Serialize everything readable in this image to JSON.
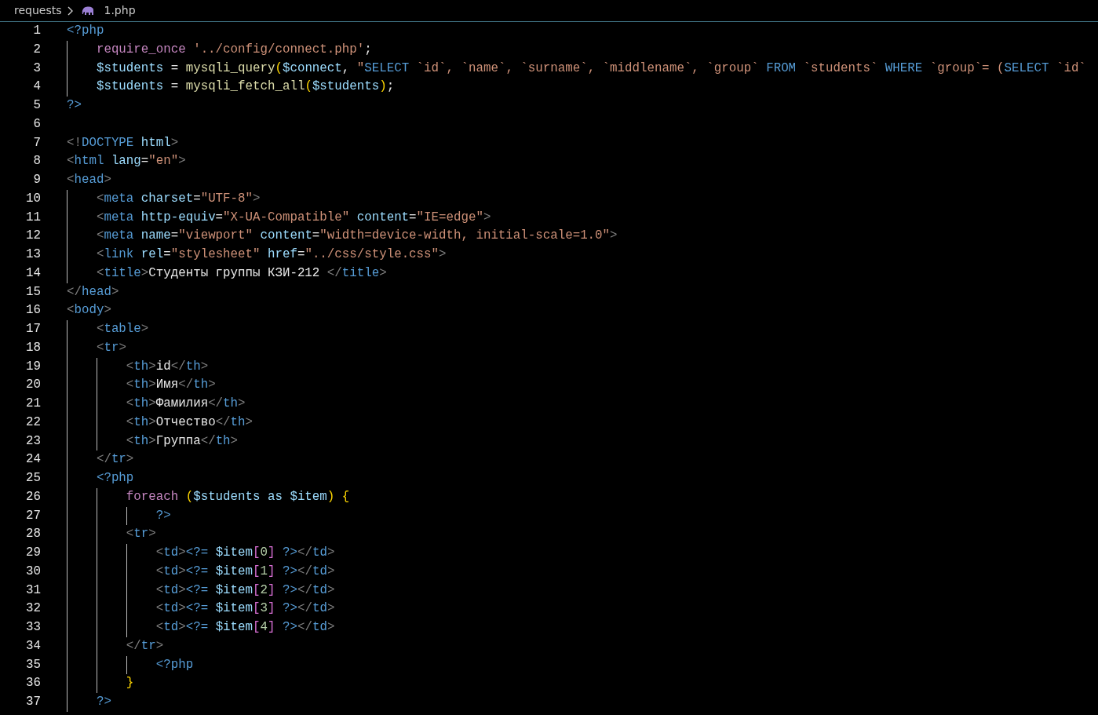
{
  "breadcrumb": {
    "folder": "requests",
    "file": "1.php"
  },
  "lines": [
    {
      "number": "1",
      "tokens": [
        {
          "kind": "php",
          "text": "<?php"
        }
      ]
    },
    {
      "number": "2",
      "tokens": [
        {
          "kind": "kw",
          "text": "    require_once "
        },
        {
          "kind": "str",
          "text": "'../config/connect.php'"
        },
        {
          "kind": "plain",
          "text": ";"
        }
      ]
    },
    {
      "number": "3",
      "tokens": [
        {
          "kind": "var",
          "text": "    $students"
        },
        {
          "kind": "plain",
          "text": " = "
        },
        {
          "kind": "fn",
          "text": "mysqli_query"
        },
        {
          "kind": "br1",
          "text": "("
        },
        {
          "kind": "var",
          "text": "$connect"
        },
        {
          "kind": "plain",
          "text": ", "
        },
        {
          "kind": "str",
          "text": "\""
        },
        {
          "kind": "sql",
          "text": "SELECT"
        },
        {
          "kind": "str",
          "text": " `id`, `name`, `surname`, `middlename`, `group` "
        },
        {
          "kind": "sql",
          "text": "FROM"
        },
        {
          "kind": "str",
          "text": " `students` "
        },
        {
          "kind": "sql",
          "text": "WHERE"
        },
        {
          "kind": "str",
          "text": " `group`= ("
        },
        {
          "kind": "sql",
          "text": "SELECT"
        },
        {
          "kind": "str",
          "text": " `id`"
        }
      ]
    },
    {
      "number": "4",
      "tokens": [
        {
          "kind": "var",
          "text": "    $students"
        },
        {
          "kind": "plain",
          "text": " = "
        },
        {
          "kind": "fn",
          "text": "mysqli_fetch_all"
        },
        {
          "kind": "br1",
          "text": "("
        },
        {
          "kind": "var",
          "text": "$students"
        },
        {
          "kind": "br1",
          "text": ")"
        },
        {
          "kind": "plain",
          "text": ";"
        }
      ]
    },
    {
      "number": "5",
      "tokens": [
        {
          "kind": "php",
          "text": "?>"
        }
      ]
    },
    {
      "number": "6"
    },
    {
      "number": "7",
      "tokens": [
        {
          "kind": "punct",
          "text": "<!"
        },
        {
          "kind": "tag",
          "text": "DOCTYPE "
        },
        {
          "kind": "attr",
          "text": "html"
        },
        {
          "kind": "punct",
          "text": ">"
        }
      ]
    },
    {
      "number": "8",
      "tokens": [
        {
          "kind": "punct",
          "text": "<"
        },
        {
          "kind": "tag",
          "text": "html "
        },
        {
          "kind": "attr",
          "text": "lang"
        },
        {
          "kind": "plain",
          "text": "="
        },
        {
          "kind": "str",
          "text": "\"en\""
        },
        {
          "kind": "punct",
          "text": ">"
        }
      ]
    },
    {
      "number": "9",
      "tokens": [
        {
          "kind": "punct",
          "text": "<"
        },
        {
          "kind": "tag",
          "text": "head"
        },
        {
          "kind": "punct",
          "text": ">"
        }
      ]
    },
    {
      "number": "10",
      "tokens": [
        {
          "kind": "punct",
          "text": "    <"
        },
        {
          "kind": "tag",
          "text": "meta "
        },
        {
          "kind": "attr",
          "text": "charset"
        },
        {
          "kind": "plain",
          "text": "="
        },
        {
          "kind": "str",
          "text": "\"UTF-8\""
        },
        {
          "kind": "punct",
          "text": ">"
        }
      ]
    },
    {
      "number": "11",
      "tokens": [
        {
          "kind": "punct",
          "text": "    <"
        },
        {
          "kind": "tag",
          "text": "meta "
        },
        {
          "kind": "attr",
          "text": "http-equiv"
        },
        {
          "kind": "plain",
          "text": "="
        },
        {
          "kind": "str",
          "text": "\"X-UA-Compatible\" "
        },
        {
          "kind": "attr",
          "text": "content"
        },
        {
          "kind": "plain",
          "text": "="
        },
        {
          "kind": "str",
          "text": "\"IE=edge\""
        },
        {
          "kind": "punct",
          "text": ">"
        }
      ]
    },
    {
      "number": "12",
      "tokens": [
        {
          "kind": "punct",
          "text": "    <"
        },
        {
          "kind": "tag",
          "text": "meta "
        },
        {
          "kind": "attr",
          "text": "name"
        },
        {
          "kind": "plain",
          "text": "="
        },
        {
          "kind": "str",
          "text": "\"viewport\" "
        },
        {
          "kind": "attr",
          "text": "content"
        },
        {
          "kind": "plain",
          "text": "="
        },
        {
          "kind": "str",
          "text": "\"width=device-width, initial-scale=1.0\""
        },
        {
          "kind": "punct",
          "text": ">"
        }
      ]
    },
    {
      "number": "13",
      "tokens": [
        {
          "kind": "punct",
          "text": "    <"
        },
        {
          "kind": "tag",
          "text": "link "
        },
        {
          "kind": "attr",
          "text": "rel"
        },
        {
          "kind": "plain",
          "text": "="
        },
        {
          "kind": "str",
          "text": "\"stylesheet\" "
        },
        {
          "kind": "attr",
          "text": "href"
        },
        {
          "kind": "plain",
          "text": "="
        },
        {
          "kind": "str",
          "text": "\"../css/style.css\""
        },
        {
          "kind": "punct",
          "text": ">"
        }
      ]
    },
    {
      "number": "14",
      "tokens": [
        {
          "kind": "punct",
          "text": "    <"
        },
        {
          "kind": "tag",
          "text": "title"
        },
        {
          "kind": "punct",
          "text": ">"
        },
        {
          "kind": "plain",
          "text": "Студенты группы КЗИ-212 "
        },
        {
          "kind": "punct",
          "text": "</"
        },
        {
          "kind": "tag",
          "text": "title"
        },
        {
          "kind": "punct",
          "text": ">"
        }
      ]
    },
    {
      "number": "15",
      "tokens": [
        {
          "kind": "punct",
          "text": "</"
        },
        {
          "kind": "tag",
          "text": "head"
        },
        {
          "kind": "punct",
          "text": ">"
        }
      ]
    },
    {
      "number": "16",
      "tokens": [
        {
          "kind": "punct",
          "text": "<"
        },
        {
          "kind": "tag",
          "text": "body"
        },
        {
          "kind": "punct",
          "text": ">"
        }
      ]
    },
    {
      "number": "17",
      "tokens": [
        {
          "kind": "punct",
          "text": "    <"
        },
        {
          "kind": "tag",
          "text": "table"
        },
        {
          "kind": "punct",
          "text": ">"
        }
      ]
    },
    {
      "number": "18",
      "tokens": [
        {
          "kind": "punct",
          "text": "    <"
        },
        {
          "kind": "tag",
          "text": "tr"
        },
        {
          "kind": "punct",
          "text": ">"
        }
      ]
    },
    {
      "number": "19",
      "tokens": [
        {
          "kind": "punct",
          "text": "        <"
        },
        {
          "kind": "tag",
          "text": "th"
        },
        {
          "kind": "punct",
          "text": ">"
        },
        {
          "kind": "plain",
          "text": "id"
        },
        {
          "kind": "punct",
          "text": "</"
        },
        {
          "kind": "tag",
          "text": "th"
        },
        {
          "kind": "punct",
          "text": ">"
        }
      ]
    },
    {
      "number": "20",
      "tokens": [
        {
          "kind": "punct",
          "text": "        <"
        },
        {
          "kind": "tag",
          "text": "th"
        },
        {
          "kind": "punct",
          "text": ">"
        },
        {
          "kind": "plain",
          "text": "Имя"
        },
        {
          "kind": "punct",
          "text": "</"
        },
        {
          "kind": "tag",
          "text": "th"
        },
        {
          "kind": "punct",
          "text": ">"
        }
      ]
    },
    {
      "number": "21",
      "tokens": [
        {
          "kind": "punct",
          "text": "        <"
        },
        {
          "kind": "tag",
          "text": "th"
        },
        {
          "kind": "punct",
          "text": ">"
        },
        {
          "kind": "plain",
          "text": "Фамилия"
        },
        {
          "kind": "punct",
          "text": "</"
        },
        {
          "kind": "tag",
          "text": "th"
        },
        {
          "kind": "punct",
          "text": ">"
        }
      ]
    },
    {
      "number": "22",
      "tokens": [
        {
          "kind": "punct",
          "text": "        <"
        },
        {
          "kind": "tag",
          "text": "th"
        },
        {
          "kind": "punct",
          "text": ">"
        },
        {
          "kind": "plain",
          "text": "Отчество"
        },
        {
          "kind": "punct",
          "text": "</"
        },
        {
          "kind": "tag",
          "text": "th"
        },
        {
          "kind": "punct",
          "text": ">"
        }
      ]
    },
    {
      "number": "23",
      "tokens": [
        {
          "kind": "punct",
          "text": "        <"
        },
        {
          "kind": "tag",
          "text": "th"
        },
        {
          "kind": "punct",
          "text": ">"
        },
        {
          "kind": "plain",
          "text": "Группа"
        },
        {
          "kind": "punct",
          "text": "</"
        },
        {
          "kind": "tag",
          "text": "th"
        },
        {
          "kind": "punct",
          "text": ">"
        }
      ]
    },
    {
      "number": "24",
      "tokens": [
        {
          "kind": "punct",
          "text": "    </"
        },
        {
          "kind": "tag",
          "text": "tr"
        },
        {
          "kind": "punct",
          "text": ">"
        }
      ]
    },
    {
      "number": "25",
      "tokens": [
        {
          "kind": "php",
          "text": "    <?php"
        }
      ]
    },
    {
      "number": "26",
      "tokens": [
        {
          "kind": "kw",
          "text": "        foreach "
        },
        {
          "kind": "br1",
          "text": "("
        },
        {
          "kind": "var",
          "text": "$students as $item"
        },
        {
          "kind": "br1",
          "text": ") "
        },
        {
          "kind": "br1",
          "text": "{"
        }
      ]
    },
    {
      "number": "27",
      "tokens": [
        {
          "kind": "php",
          "text": "            ?>"
        }
      ]
    },
    {
      "number": "28",
      "tokens": [
        {
          "kind": "punct",
          "text": "        <"
        },
        {
          "kind": "tag",
          "text": "tr"
        },
        {
          "kind": "punct",
          "text": ">"
        }
      ]
    },
    {
      "number": "29",
      "tokens": [
        {
          "kind": "punct",
          "text": "            <"
        },
        {
          "kind": "tag",
          "text": "td"
        },
        {
          "kind": "punct",
          "text": ">"
        },
        {
          "kind": "php",
          "text": "<?= "
        },
        {
          "kind": "var",
          "text": "$item"
        },
        {
          "kind": "br2",
          "text": "["
        },
        {
          "kind": "num",
          "text": "0"
        },
        {
          "kind": "br2",
          "text": "] "
        },
        {
          "kind": "php",
          "text": "?>"
        },
        {
          "kind": "punct",
          "text": "</"
        },
        {
          "kind": "tag",
          "text": "td"
        },
        {
          "kind": "punct",
          "text": ">"
        }
      ]
    },
    {
      "number": "30",
      "tokens": [
        {
          "kind": "punct",
          "text": "            <"
        },
        {
          "kind": "tag",
          "text": "td"
        },
        {
          "kind": "punct",
          "text": ">"
        },
        {
          "kind": "php",
          "text": "<?= "
        },
        {
          "kind": "var",
          "text": "$item"
        },
        {
          "kind": "br2",
          "text": "["
        },
        {
          "kind": "num",
          "text": "1"
        },
        {
          "kind": "br2",
          "text": "] "
        },
        {
          "kind": "php",
          "text": "?>"
        },
        {
          "kind": "punct",
          "text": "</"
        },
        {
          "kind": "tag",
          "text": "td"
        },
        {
          "kind": "punct",
          "text": ">"
        }
      ]
    },
    {
      "number": "31",
      "tokens": [
        {
          "kind": "punct",
          "text": "            <"
        },
        {
          "kind": "tag",
          "text": "td"
        },
        {
          "kind": "punct",
          "text": ">"
        },
        {
          "kind": "php",
          "text": "<?= "
        },
        {
          "kind": "var",
          "text": "$item"
        },
        {
          "kind": "br2",
          "text": "["
        },
        {
          "kind": "num",
          "text": "2"
        },
        {
          "kind": "br2",
          "text": "] "
        },
        {
          "kind": "php",
          "text": "?>"
        },
        {
          "kind": "punct",
          "text": "</"
        },
        {
          "kind": "tag",
          "text": "td"
        },
        {
          "kind": "punct",
          "text": ">"
        }
      ]
    },
    {
      "number": "32",
      "tokens": [
        {
          "kind": "punct",
          "text": "            <"
        },
        {
          "kind": "tag",
          "text": "td"
        },
        {
          "kind": "punct",
          "text": ">"
        },
        {
          "kind": "php",
          "text": "<?= "
        },
        {
          "kind": "var",
          "text": "$item"
        },
        {
          "kind": "br2",
          "text": "["
        },
        {
          "kind": "num",
          "text": "3"
        },
        {
          "kind": "br2",
          "text": "] "
        },
        {
          "kind": "php",
          "text": "?>"
        },
        {
          "kind": "punct",
          "text": "</"
        },
        {
          "kind": "tag",
          "text": "td"
        },
        {
          "kind": "punct",
          "text": ">"
        }
      ]
    },
    {
      "number": "33",
      "tokens": [
        {
          "kind": "punct",
          "text": "            <"
        },
        {
          "kind": "tag",
          "text": "td"
        },
        {
          "kind": "punct",
          "text": ">"
        },
        {
          "kind": "php",
          "text": "<?= "
        },
        {
          "kind": "var",
          "text": "$item"
        },
        {
          "kind": "br2",
          "text": "["
        },
        {
          "kind": "num",
          "text": "4"
        },
        {
          "kind": "br2",
          "text": "] "
        },
        {
          "kind": "php",
          "text": "?>"
        },
        {
          "kind": "punct",
          "text": "</"
        },
        {
          "kind": "tag",
          "text": "td"
        },
        {
          "kind": "punct",
          "text": ">"
        }
      ]
    },
    {
      "number": "34",
      "tokens": [
        {
          "kind": "punct",
          "text": "        </"
        },
        {
          "kind": "tag",
          "text": "tr"
        },
        {
          "kind": "punct",
          "text": ">"
        }
      ]
    },
    {
      "number": "35",
      "tokens": [
        {
          "kind": "php",
          "text": "            <?php"
        }
      ]
    },
    {
      "number": "36",
      "tokens": [
        {
          "kind": "br1",
          "text": "        }"
        }
      ]
    },
    {
      "number": "37",
      "tokens": [
        {
          "kind": "php",
          "text": "    ?>"
        }
      ]
    }
  ]
}
